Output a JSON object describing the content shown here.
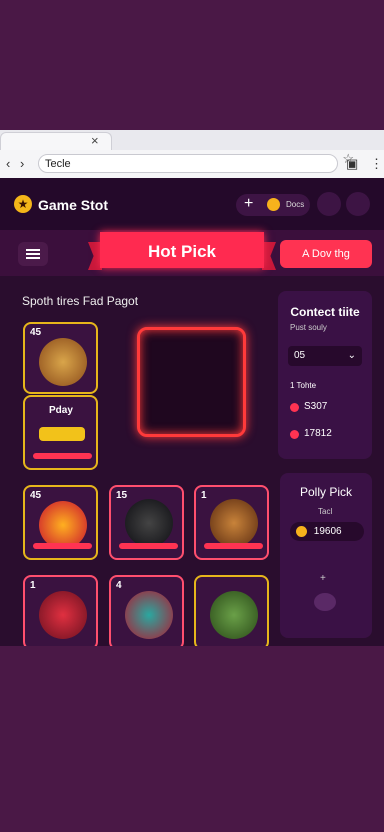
{
  "browser": {
    "tab_close": "×",
    "url": "Tecle",
    "nav": {
      "back": "‹",
      "forward": "›"
    },
    "star": "☆"
  },
  "header": {
    "brand": "Game Stot",
    "wallet_value": "Docs",
    "wallet_plus": "+"
  },
  "hero": {
    "title": "Hot Pick",
    "cta": "A Dov thg"
  },
  "section": {
    "title": "Spoth tires Fad Pagot"
  },
  "cards": [
    {
      "num": "45"
    },
    {
      "label": "Pday"
    },
    {
      "num": "45"
    },
    {
      "num": "15"
    },
    {
      "num": "1"
    },
    {
      "num": "1"
    },
    {
      "num": "4"
    }
  ],
  "contest": {
    "title": "Contect tiite",
    "subtitle": "Pust souly",
    "select_value": "05",
    "row_label": "1 Tohte",
    "values": [
      "S307",
      "17812"
    ]
  },
  "poll": {
    "title": "Polly Pick",
    "sub": "Tacl",
    "value": "19606"
  },
  "colors": {
    "accent": "#ff3352",
    "gold": "#e6b61b",
    "bg": "#2a0d2e"
  }
}
